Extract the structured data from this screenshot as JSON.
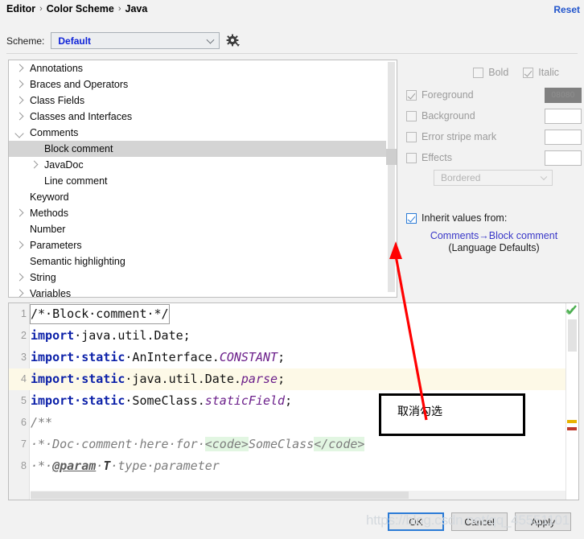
{
  "breadcrumb": {
    "items": [
      "Editor",
      "Color Scheme",
      "Java"
    ],
    "separator": "›"
  },
  "header": {
    "reset_label": "Reset"
  },
  "scheme": {
    "label": "Scheme:",
    "value": "Default",
    "gear_icon": "gear-icon"
  },
  "tree": {
    "items": [
      {
        "label": "Annotations",
        "twisty": "closed",
        "indent": 0,
        "selected": false
      },
      {
        "label": "Braces and Operators",
        "twisty": "closed",
        "indent": 0,
        "selected": false
      },
      {
        "label": "Class Fields",
        "twisty": "closed",
        "indent": 0,
        "selected": false
      },
      {
        "label": "Classes and Interfaces",
        "twisty": "closed",
        "indent": 0,
        "selected": false
      },
      {
        "label": "Comments",
        "twisty": "open",
        "indent": 0,
        "selected": false
      },
      {
        "label": "Block comment",
        "twisty": "none",
        "indent": 1,
        "selected": true
      },
      {
        "label": "JavaDoc",
        "twisty": "closed",
        "indent": 1,
        "selected": false
      },
      {
        "label": "Line comment",
        "twisty": "none",
        "indent": 1,
        "selected": false
      },
      {
        "label": "Keyword",
        "twisty": "none",
        "indent": 0,
        "selected": false
      },
      {
        "label": "Methods",
        "twisty": "closed",
        "indent": 0,
        "selected": false
      },
      {
        "label": "Number",
        "twisty": "none",
        "indent": 0,
        "selected": false
      },
      {
        "label": "Parameters",
        "twisty": "closed",
        "indent": 0,
        "selected": false
      },
      {
        "label": "Semantic highlighting",
        "twisty": "none",
        "indent": 0,
        "selected": false
      },
      {
        "label": "String",
        "twisty": "closed",
        "indent": 0,
        "selected": false
      },
      {
        "label": "Variables",
        "twisty": "closed",
        "indent": 0,
        "selected": false
      }
    ]
  },
  "attributes": {
    "bold": {
      "label": "Bold",
      "checked": false,
      "enabled": false
    },
    "italic": {
      "label": "Italic",
      "checked": true,
      "enabled": false
    },
    "foreground": {
      "label": "Foreground",
      "checked": true,
      "enabled": false,
      "color": "808080",
      "swatch_text": "08080"
    },
    "background": {
      "label": "Background",
      "checked": false,
      "enabled": false,
      "color": ""
    },
    "error_stripe_mark": {
      "label": "Error stripe mark",
      "checked": false,
      "enabled": false,
      "color": ""
    },
    "effects": {
      "label": "Effects",
      "checked": false,
      "enabled": false,
      "color": ""
    },
    "effect_type": {
      "value": "Bordered"
    },
    "inherit": {
      "label": "Inherit values from:",
      "checked": true,
      "link": "Comments→Block comment",
      "sub": "(Language Defaults)",
      "link_color": "#3a38c8"
    }
  },
  "preview": {
    "lines": [
      {
        "num": "1",
        "highlight": false,
        "boxed": true,
        "tokens": [
          {
            "t": "/*·Block·comment·*/",
            "c": "plain"
          }
        ]
      },
      {
        "num": "2",
        "highlight": false,
        "boxed": false,
        "tokens": [
          {
            "t": "import",
            "c": "kw"
          },
          {
            "t": "·java.util.Date;",
            "c": "plain"
          }
        ]
      },
      {
        "num": "3",
        "highlight": false,
        "boxed": false,
        "tokens": [
          {
            "t": "import·static",
            "c": "kw"
          },
          {
            "t": "·AnInterface.",
            "c": "plain"
          },
          {
            "t": "CONSTANT",
            "c": "const"
          },
          {
            "t": ";",
            "c": "plain"
          }
        ]
      },
      {
        "num": "4",
        "highlight": true,
        "boxed": false,
        "tokens": [
          {
            "t": "import·static",
            "c": "kw"
          },
          {
            "t": "·java.util.Date.",
            "c": "plain"
          },
          {
            "t": "parse",
            "c": "field"
          },
          {
            "t": ";",
            "c": "plain"
          }
        ]
      },
      {
        "num": "5",
        "highlight": false,
        "boxed": false,
        "tokens": [
          {
            "t": "import·static",
            "c": "kw"
          },
          {
            "t": "·SomeClass.",
            "c": "plain"
          },
          {
            "t": "staticField",
            "c": "field"
          },
          {
            "t": ";",
            "c": "plain"
          }
        ]
      },
      {
        "num": "6",
        "highlight": false,
        "boxed": false,
        "tokens": [
          {
            "t": "/**",
            "c": "cmt"
          }
        ]
      },
      {
        "num": "7",
        "highlight": false,
        "boxed": false,
        "tokens": [
          {
            "t": "·*·Doc·comment·here·for·",
            "c": "cmt"
          },
          {
            "t": "<code>",
            "c": "cmt-tag"
          },
          {
            "t": "SomeClass",
            "c": "cmt"
          },
          {
            "t": "</code>",
            "c": "cmt-tag"
          }
        ]
      },
      {
        "num": "8",
        "highlight": false,
        "boxed": false,
        "tokens": [
          {
            "t": "·*·",
            "c": "cmt"
          },
          {
            "t": "@param",
            "c": "cmt-at"
          },
          {
            "t": "·",
            "c": "cmt"
          },
          {
            "t": "T",
            "c": "cmt-b"
          },
          {
            "t": "·type·parameter",
            "c": "cmt"
          }
        ]
      }
    ],
    "status_icon": "green-check-icon"
  },
  "annotation": {
    "text": "取消勾选",
    "arrow_color": "#ff0000"
  },
  "footer": {
    "ok": "OK",
    "cancel": "Cancel",
    "apply": "Apply"
  },
  "watermark": {
    "text": "https://blog.csdn.net/qq_45551101"
  }
}
